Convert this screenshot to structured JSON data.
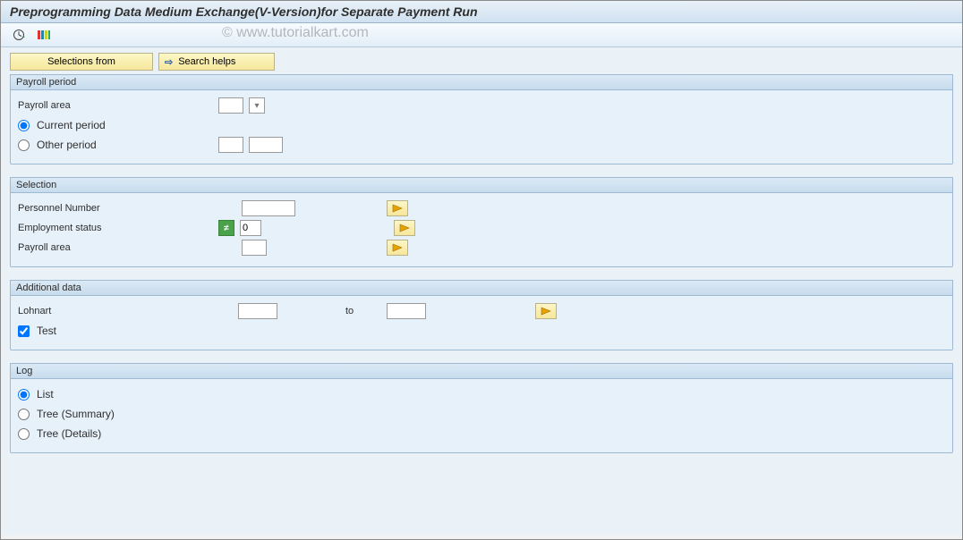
{
  "title": "Preprogramming Data Medium Exchange(V-Version)for Separate Payment Run",
  "watermark": "© www.tutorialkart.com",
  "buttons": {
    "selections_from": "Selections from",
    "search_helps": "Search helps"
  },
  "groups": {
    "payroll_period": {
      "title": "Payroll period",
      "payroll_area_label": "Payroll area",
      "current_period_label": "Current period",
      "other_period_label": "Other period"
    },
    "selection": {
      "title": "Selection",
      "personnel_number_label": "Personnel Number",
      "employment_status_label": "Employment status",
      "employment_status_value": "0",
      "payroll_area_label": "Payroll area"
    },
    "additional": {
      "title": "Additional data",
      "lohnart_label": "Lohnart",
      "to_label": "to",
      "test_label": "Test",
      "test_checked": true
    },
    "log": {
      "title": "Log",
      "list_label": "List",
      "tree_summary_label": "Tree (Summary)",
      "tree_details_label": "Tree (Details)"
    }
  }
}
